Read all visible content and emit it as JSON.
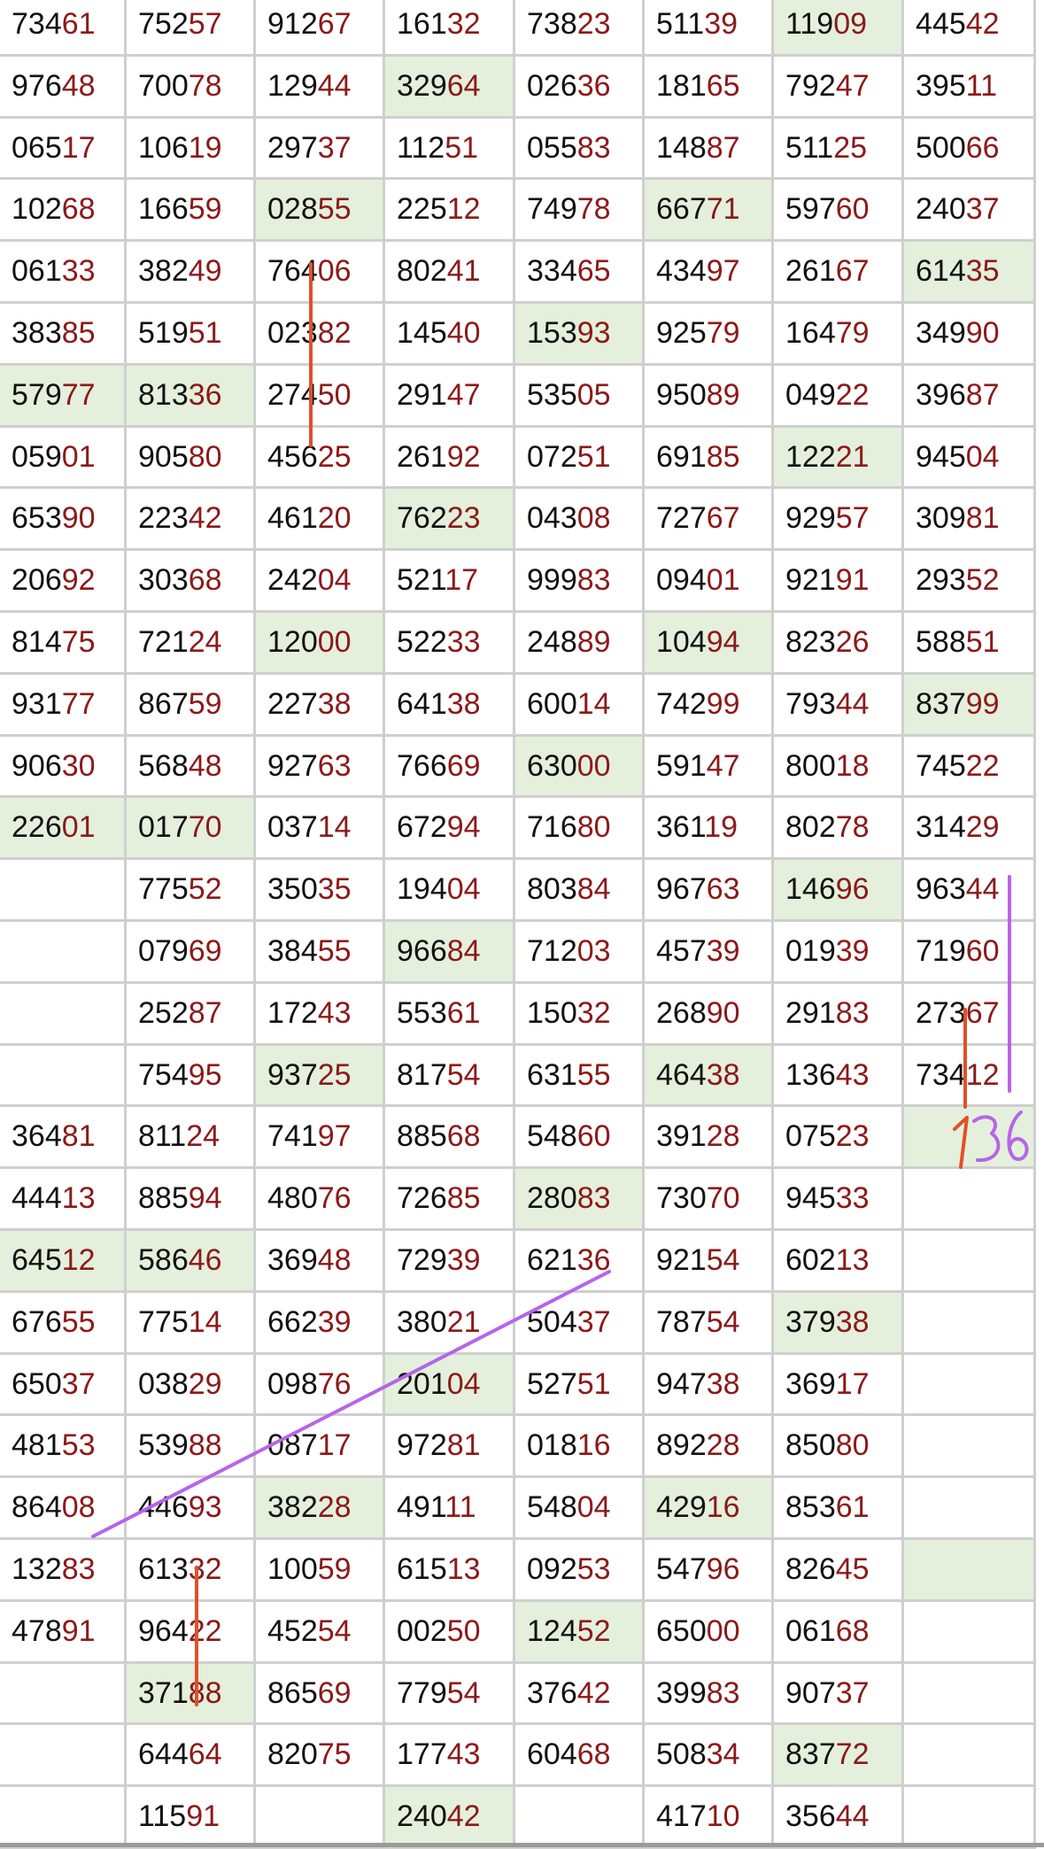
{
  "table": {
    "rows": [
      [
        "73461",
        "75257",
        "91267",
        "16132",
        "73823",
        "51139",
        "11909",
        "44542"
      ],
      [
        "97648",
        "70078",
        "12944",
        "32964",
        "02636",
        "18165",
        "79247",
        "39511"
      ],
      [
        "06517",
        "10619",
        "29737",
        "11251",
        "05583",
        "14887",
        "51125",
        "50066"
      ],
      [
        "10268",
        "16659",
        "02855",
        "22512",
        "74978",
        "66771",
        "59760",
        "24037"
      ],
      [
        "06133",
        "38249",
        "76406",
        "80241",
        "33465",
        "43497",
        "26167",
        "61435"
      ],
      [
        "38385",
        "51951",
        "02382",
        "14540",
        "15393",
        "92579",
        "16479",
        "34990"
      ],
      [
        "57977",
        "81336",
        "27450",
        "29147",
        "53505",
        "95089",
        "04922",
        "39687"
      ],
      [
        "05901",
        "90580",
        "45625",
        "26192",
        "07251",
        "69185",
        "12221",
        "94504"
      ],
      [
        "65390",
        "22342",
        "46120",
        "76223",
        "04308",
        "72767",
        "92957",
        "30981"
      ],
      [
        "20692",
        "30368",
        "24204",
        "52117",
        "99983",
        "09401",
        "92191",
        "29352"
      ],
      [
        "81475",
        "72124",
        "12000",
        "52233",
        "24889",
        "10494",
        "82326",
        "58851"
      ],
      [
        "93177",
        "86759",
        "22738",
        "64138",
        "60014",
        "74299",
        "79344",
        "83799"
      ],
      [
        "90630",
        "56848",
        "92763",
        "76669",
        "63000",
        "59147",
        "80018",
        "74522"
      ],
      [
        "22601",
        "01770",
        "03714",
        "67294",
        "71680",
        "36119",
        "80278",
        "31429"
      ],
      [
        "",
        "77552",
        "35035",
        "19404",
        "80384",
        "96763",
        "14696",
        "96344"
      ],
      [
        "",
        "07969",
        "38455",
        "96684",
        "71203",
        "45739",
        "01939",
        "71960"
      ],
      [
        "",
        "25287",
        "17243",
        "55361",
        "15032",
        "26890",
        "29183",
        "27367"
      ],
      [
        "",
        "75495",
        "93725",
        "81754",
        "63155",
        "46438",
        "13643",
        "73412"
      ],
      [
        "36481",
        "81124",
        "74197",
        "88568",
        "54860",
        "39128",
        "07523",
        ""
      ],
      [
        "44413",
        "88594",
        "48076",
        "72685",
        "28083",
        "73070",
        "94533",
        ""
      ],
      [
        "64512",
        "58646",
        "36948",
        "72939",
        "62136",
        "92154",
        "60213",
        ""
      ],
      [
        "67655",
        "77514",
        "66239",
        "38021",
        "50437",
        "78754",
        "37938",
        ""
      ],
      [
        "65037",
        "03829",
        "09876",
        "20104",
        "52751",
        "94738",
        "36917",
        ""
      ],
      [
        "48153",
        "53988",
        "08717",
        "97281",
        "01816",
        "89228",
        "85080",
        ""
      ],
      [
        "86408",
        "44693",
        "38228",
        "49111",
        "54804",
        "42916",
        "85361",
        ""
      ],
      [
        "13283",
        "61332",
        "10059",
        "61513",
        "09253",
        "54796",
        "82645",
        ""
      ],
      [
        "47891",
        "96422",
        "45254",
        "00250",
        "12452",
        "65000",
        "06168",
        ""
      ],
      [
        "",
        "37188",
        "86569",
        "77954",
        "37642",
        "39983",
        "90737",
        ""
      ],
      [
        "",
        "64464",
        "82075",
        "17743",
        "60468",
        "50834",
        "83772",
        ""
      ],
      [
        "",
        "11591",
        "",
        "24042",
        "",
        "41710",
        "35644",
        ""
      ]
    ],
    "highlights": [
      [
        0,
        6
      ],
      [
        1,
        3
      ],
      [
        3,
        2
      ],
      [
        3,
        5
      ],
      [
        4,
        7
      ],
      [
        5,
        4
      ],
      [
        6,
        0
      ],
      [
        6,
        1
      ],
      [
        7,
        6
      ],
      [
        8,
        3
      ],
      [
        10,
        2
      ],
      [
        10,
        5
      ],
      [
        11,
        7
      ],
      [
        12,
        4
      ],
      [
        13,
        0
      ],
      [
        13,
        1
      ],
      [
        14,
        6
      ],
      [
        15,
        3
      ],
      [
        17,
        2
      ],
      [
        17,
        5
      ],
      [
        18,
        7
      ],
      [
        19,
        4
      ],
      [
        20,
        0
      ],
      [
        20,
        1
      ],
      [
        21,
        6
      ],
      [
        22,
        3
      ],
      [
        24,
        2
      ],
      [
        24,
        5
      ],
      [
        25,
        7
      ],
      [
        26,
        4
      ],
      [
        27,
        1
      ],
      [
        28,
        6
      ],
      [
        29,
        3
      ]
    ],
    "highlight_color": "#e4f0dc",
    "grid_color": "#cfcfcf",
    "tail_color": "#8b1a1a"
  },
  "annotations": {
    "handwritten_number": "136",
    "red_color": "#e0512b",
    "purple_color": "#b565e8"
  }
}
